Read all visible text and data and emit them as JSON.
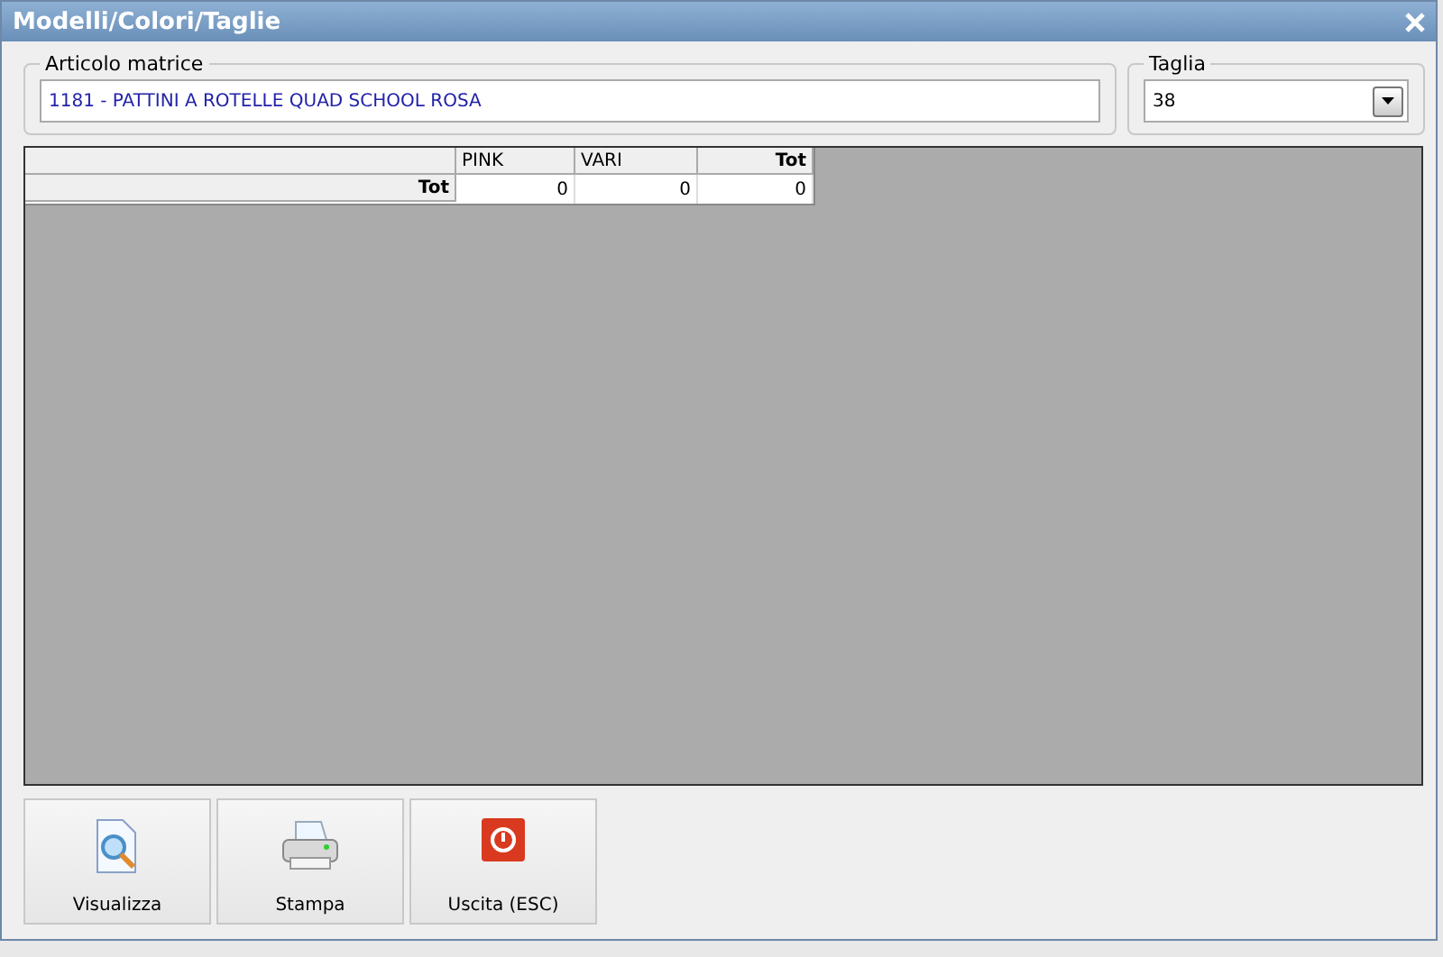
{
  "window": {
    "title": "Modelli/Colori/Taglie"
  },
  "article": {
    "label": "Articolo matrice",
    "value": "1181 - PATTINI A ROTELLE QUAD SCHOOL ROSA"
  },
  "size": {
    "label": "Taglia",
    "value": "38"
  },
  "grid": {
    "columns": [
      {
        "label": "PINK",
        "bold": false
      },
      {
        "label": "VARI",
        "bold": false
      },
      {
        "label": "Tot",
        "bold": true
      }
    ],
    "rows": [
      {
        "label": "Tot",
        "cells": [
          "0",
          "0",
          "0"
        ]
      }
    ]
  },
  "buttons": [
    {
      "label": "Visualizza",
      "kind": "preview"
    },
    {
      "label": "Stampa",
      "kind": "print"
    },
    {
      "label": "Uscita (ESC)",
      "kind": "exit"
    }
  ]
}
